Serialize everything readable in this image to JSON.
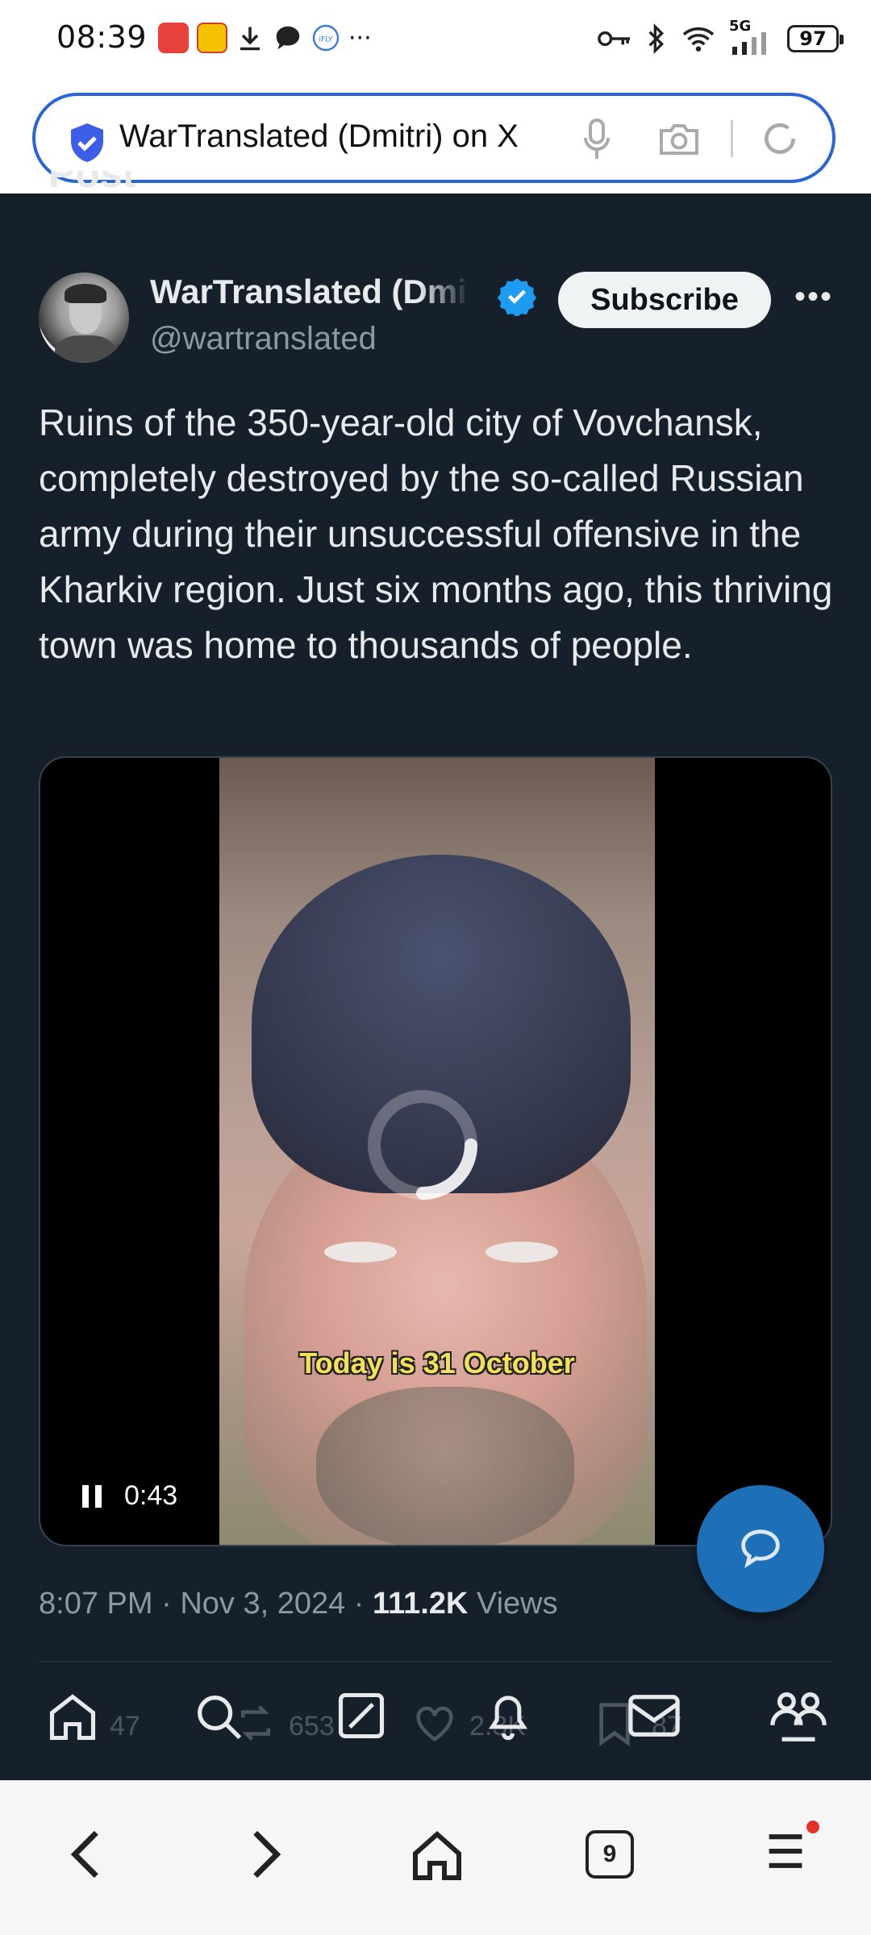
{
  "status_bar": {
    "time": "08:39",
    "battery": "97",
    "network": "5G",
    "overflow": "···"
  },
  "browser": {
    "url_text": "WarTranslated (Dmitri) on X",
    "tab_count": "9"
  },
  "post": {
    "header_peek": "Post",
    "display_name": "WarTranslated (Dmitri)",
    "handle": "@wartranslated",
    "subscribe_label": "Subscribe",
    "text": "Ruins of the 350-year-old city of Vovchansk, completely destroyed by the so-called Russian army during their unsuccessful offensive in the Kharkiv region. Just six months ago, this thriving town was home to thousands of people.",
    "video": {
      "caption": "Today is 31 October",
      "elapsed": "0:43"
    },
    "time": "8:07 PM",
    "date": "Nov 3, 2024",
    "views_count": "111.2K",
    "views_label": "Views",
    "replies": "47",
    "reposts": "653",
    "likes": "2.3K",
    "bookmarks": "87"
  },
  "colors": {
    "background": "#15202b",
    "accent": "#1d9bf0",
    "address_border": "#2a65d8"
  }
}
